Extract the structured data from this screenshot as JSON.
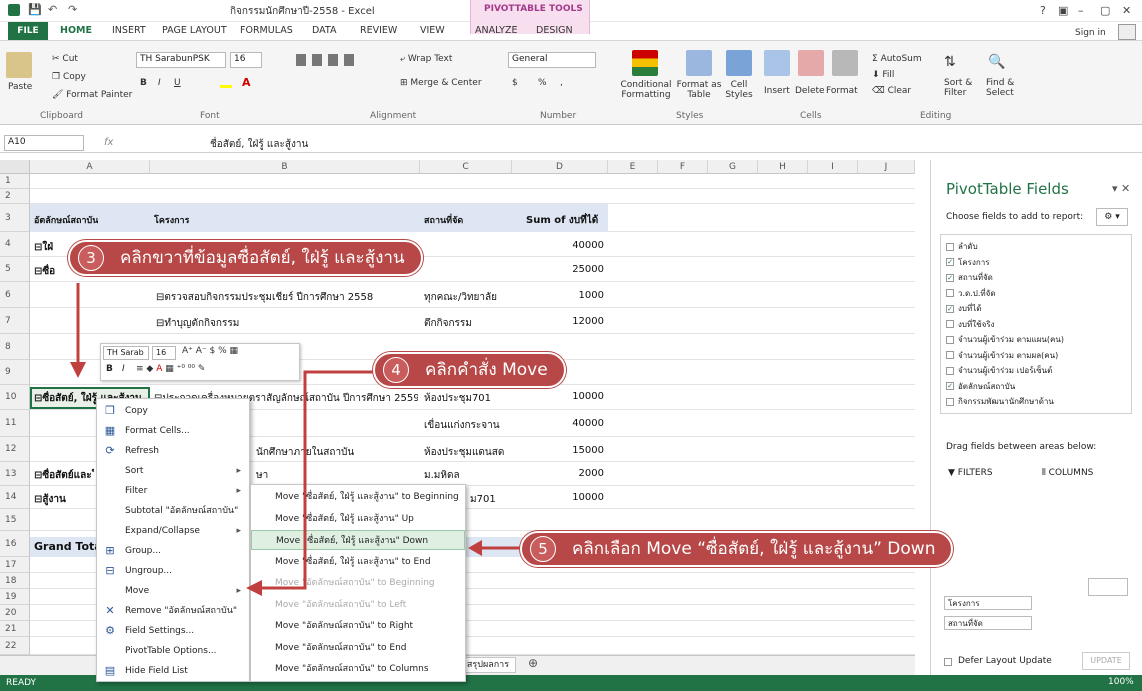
{
  "window": {
    "title": "กิจกรรมนักศึกษาปี-2558 - Excel",
    "context_tab_group": "PIVOTTABLE TOOLS",
    "sign_in": "Sign in",
    "help": "?",
    "minimize": "–",
    "maximize": "▢",
    "close": "✕"
  },
  "tabs": [
    "FILE",
    "HOME",
    "INSERT",
    "PAGE LAYOUT",
    "FORMULAS",
    "DATA",
    "REVIEW",
    "VIEW",
    "ANALYZE",
    "DESIGN"
  ],
  "ribbon": {
    "clipboard": {
      "paste": "Paste",
      "cut": "Cut",
      "copy": "Copy",
      "format_painter": "Format Painter",
      "label": "Clipboard"
    },
    "font": {
      "name": "TH SarabunPSK",
      "size": "16",
      "bold": "B",
      "italic": "I",
      "underline": "U",
      "label": "Font"
    },
    "alignment": {
      "wrap": "Wrap Text",
      "merge": "Merge & Center",
      "label": "Alignment"
    },
    "number": {
      "format": "General",
      "currency": "$",
      "percent": "%",
      "comma": ",",
      "label": "Number"
    },
    "styles": {
      "conditional": "Conditional Formatting",
      "format_table": "Format as Table",
      "cell_styles": "Cell Styles",
      "label": "Styles"
    },
    "cells": {
      "insert": "Insert",
      "delete": "Delete",
      "format": "Format",
      "label": "Cells"
    },
    "editing": {
      "autosum": "AutoSum",
      "fill": "Fill",
      "clear": "Clear",
      "sort": "Sort & Filter",
      "find": "Find & Select",
      "label": "Editing"
    }
  },
  "formula_bar": {
    "name_box": "A10",
    "fx": "fx",
    "value": "ชื่อสัตย์, ใฝ่รู้  และสู้งาน"
  },
  "columns": [
    "A",
    "B",
    "C",
    "D",
    "E",
    "F",
    "G",
    "H",
    "I",
    "J"
  ],
  "rows": [
    "1",
    "2",
    "3",
    "4",
    "5",
    "6",
    "7",
    "8",
    "9",
    "10",
    "11",
    "12",
    "13",
    "14",
    "15",
    "16",
    "17",
    "18",
    "19",
    "20",
    "21",
    "22"
  ],
  "cells": {
    "r3a": "อัตลักษณ์สถาบัน",
    "r3b": "โครงการ",
    "r3c": "สถานที่จัด",
    "r3d": "Sum of งบที่ได้",
    "r4a": "⊟ใฝ่",
    "r4d": "40000",
    "r5a": "⊟ซื่อ",
    "r5d": "25000",
    "r6b": "⊟ตรวจสอบกิจกรรมประชุมเชียร์ ปีการศึกษา 2558",
    "r6c": "ทุกคณะ/วิทยาลัย",
    "r6d": "1000",
    "r7b": "⊟ทำบุญตักกิจกรรม",
    "r7c": "ตึกกิจกรรม",
    "r7d": "12000",
    "r10a": "⊟ซื่อสัตย์, ใฝ่รู้ และสู้งาน",
    "r10b": "⊟ประกวดเครื่องหมายตราสัญลักษณ์สถาบัน ปีการศึกษา 2559",
    "r10c": "ห้องประชุม701",
    "r10d": "10000",
    "r11c": "เขื่อนแก่งกระจาน",
    "r11d": "40000",
    "r12b": "นักศึกษาภายในสถาบัน",
    "r12c": "ห้องประชุมแดนสด",
    "r12d": "15000",
    "r13a": "⊟ซื่อสัตย์และใ",
    "r13b": "ษา",
    "r13c": "ม.มหิดล",
    "r13d": "2000",
    "r14a": "⊟สู้งาน",
    "r14c": "ม701",
    "r14d": "10000",
    "r16a": "Grand Total"
  },
  "minibar": {
    "font": "TH Sarab",
    "size": "16",
    "bold": "B",
    "italic": "I"
  },
  "context_menu": [
    {
      "label": "Copy",
      "icon": "copy-icon",
      "has_sub": false
    },
    {
      "label": "Format Cells...",
      "icon": "format-cells-icon",
      "has_sub": false
    },
    {
      "label": "Refresh",
      "icon": "refresh-icon",
      "has_sub": false
    },
    {
      "label": "Sort",
      "icon": "",
      "has_sub": true
    },
    {
      "label": "Filter",
      "icon": "",
      "has_sub": true
    },
    {
      "label": "Subtotal \"อัตลักษณ์สถาบัน\"",
      "icon": "",
      "has_sub": false
    },
    {
      "label": "Expand/Collapse",
      "icon": "",
      "has_sub": true
    },
    {
      "label": "Group...",
      "icon": "group-icon",
      "has_sub": false
    },
    {
      "label": "Ungroup...",
      "icon": "ungroup-icon",
      "has_sub": false
    },
    {
      "label": "Move",
      "icon": "",
      "has_sub": true
    },
    {
      "label": "Remove \"อัตลักษณ์สถาบัน\"",
      "icon": "remove-icon",
      "has_sub": false
    },
    {
      "label": "Field Settings...",
      "icon": "field-settings-icon",
      "has_sub": false
    },
    {
      "label": "PivotTable Options...",
      "icon": "",
      "has_sub": false
    },
    {
      "label": "Hide Field List",
      "icon": "hide-field-list-icon",
      "has_sub": false
    }
  ],
  "submenu": [
    {
      "label": "Move \"ซื่อสัตย์, ใฝ่รู้ และสู้งาน\" to Beginning",
      "state": "normal"
    },
    {
      "label": "Move \"ซื่อสัตย์, ใฝ่รู้ และสู้งาน\" Up",
      "state": "normal"
    },
    {
      "label": "Move \"ซื่อสัตย์, ใฝ่รู้ และสู้งาน\" Down",
      "state": "highlight"
    },
    {
      "label": "Move \"ซื่อสัตย์, ใฝ่รู้ และสู้งาน\" to End",
      "state": "normal"
    },
    {
      "label": "Move \"อัตลักษณ์สถาบัน\" to Beginning",
      "state": "dim"
    },
    {
      "label": "Move \"อัตลักษณ์สถาบัน\" to Left",
      "state": "dim"
    },
    {
      "label": "Move \"อัตลักษณ์สถาบัน\" to Right",
      "state": "normal"
    },
    {
      "label": "Move \"อัตลักษณ์สถาบัน\" to End",
      "state": "normal"
    },
    {
      "label": "Move \"อัตลักษณ์สถาบัน\" to Columns",
      "state": "normal"
    }
  ],
  "pivot_pane": {
    "title": "PivotTable Fields",
    "choose": "Choose fields to add to report:",
    "fields": [
      {
        "label": "ลำดับ",
        "checked": false
      },
      {
        "label": "โครงการ",
        "checked": true
      },
      {
        "label": "สถานที่จัด",
        "checked": true
      },
      {
        "label": "ว.ด.ป.ที่จัด",
        "checked": false
      },
      {
        "label": "งบที่ได้",
        "checked": true
      },
      {
        "label": "งบที่ใช้จริง",
        "checked": false
      },
      {
        "label": "จำนวนผู้เข้าร่วม ตามแผน(คน)",
        "checked": false
      },
      {
        "label": "จำนวนผู้เข้าร่วม ตามผล(คน)",
        "checked": false
      },
      {
        "label": "จำนวนผู้เข้าร่วม เปอร์เซ็นต์",
        "checked": false
      },
      {
        "label": "อัตลักษณ์สถาบัน",
        "checked": true
      },
      {
        "label": "กิจกรรมพัฒนานักศึกษาด้าน",
        "checked": false
      }
    ],
    "drag_label": "Drag fields between areas below:",
    "filters": "FILTERS",
    "columns": "COLUMNS",
    "row_items": [
      "โครงการ",
      "สถานที่จัด"
    ],
    "defer": "Defer Layout Update",
    "update": "UPDATE"
  },
  "callouts": {
    "c3": {
      "num": "3",
      "text": "คลิกขวาที่ข้อมูลซื่อสัตย์, ใฝ่รู้ และสู้งาน"
    },
    "c4": {
      "num": "4",
      "text": "คลิกคำสั่ง Move"
    },
    "c5": {
      "num": "5",
      "text": "คลิกเลือก Move “ซื่อสัตย์, ใฝ่รู้ และสู้งาน” Down"
    }
  },
  "status": {
    "ready": "READY",
    "sheet": "สรุปผลการดำเนินงาน",
    "zoom": "100%"
  },
  "colors": {
    "excel_green": "#217346",
    "callout_red": "#b84848",
    "highlight": "#dff0e3"
  }
}
